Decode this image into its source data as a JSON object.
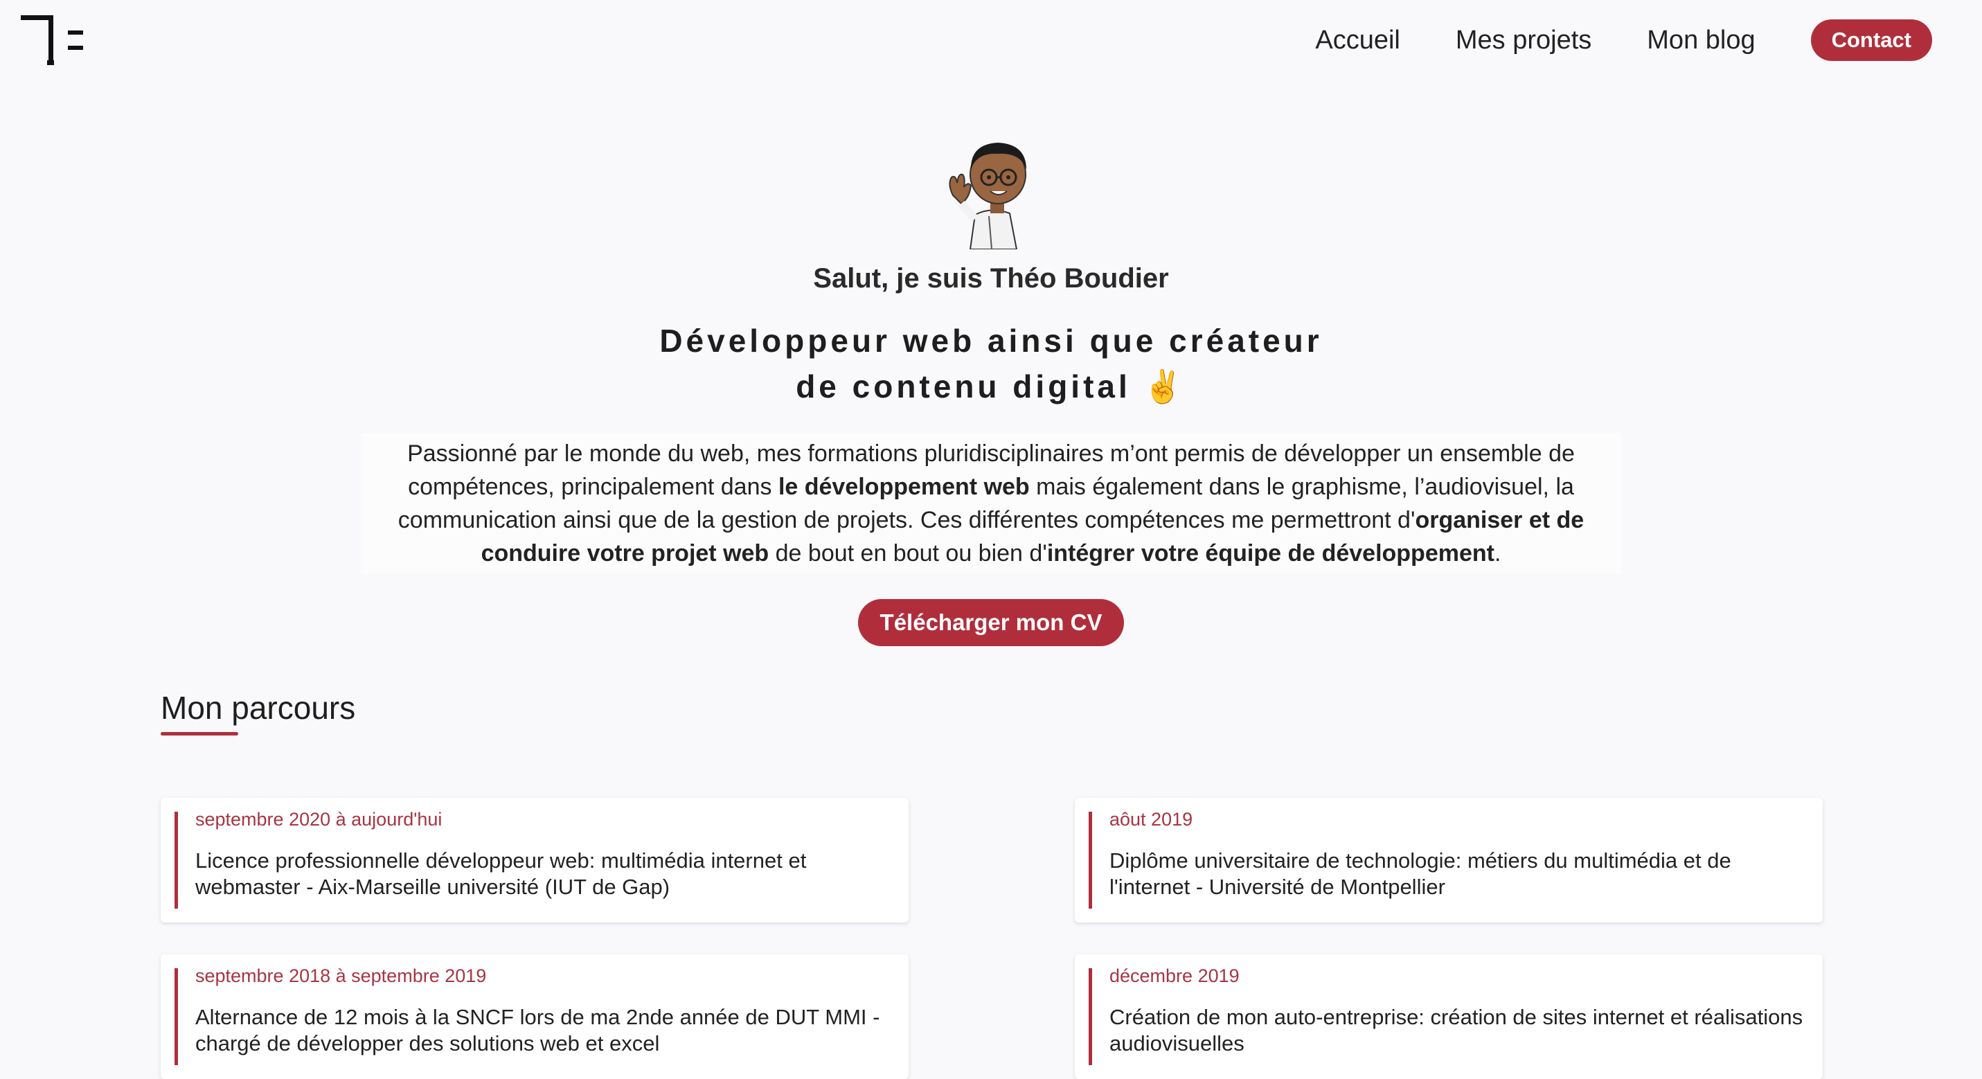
{
  "header": {
    "nav": [
      "Accueil",
      "Mes projets",
      "Mon blog"
    ],
    "cta_label": "Contact"
  },
  "hero": {
    "greeting": "Salut, je suis Théo Boudier",
    "tagline_line1": "Développeur web ainsi que créateur",
    "tagline_line2": "de contenu digital ✌️",
    "intro": {
      "p1": "Passionné par le monde du web, mes formations pluridisciplinaires m’ont permis de développer un ensemble de compétences, principalement dans ",
      "b1": "le développement web",
      "p2": " mais également dans le graphisme, l’audiovisuel, la communication ainsi que de la gestion de projets. Ces différentes compétences me permettront d'",
      "b2": "organiser et de conduire votre projet web",
      "p3": " de bout en bout ou bien d'",
      "b3": "intégrer votre équipe de développement",
      "p4": "."
    },
    "cv_button": "Télécharger mon CV"
  },
  "section": {
    "title": "Mon parcours"
  },
  "timeline": [
    {
      "date": "septembre 2020 à aujourd'hui",
      "text": "Licence professionnelle développeur web: multimédia internet et webmaster - Aix-Marseille université (IUT de Gap)"
    },
    {
      "date": "aôut 2019",
      "text": "Diplôme universitaire de technologie: métiers du multimédia et de l'internet - Université de Montpellier"
    },
    {
      "date": "septembre 2018 à septembre 2019",
      "text": "Alternance de 12 mois à la SNCF lors de ma 2nde année de DUT MMI - chargé de développer des solutions web et excel"
    },
    {
      "date": "décembre 2019",
      "text": "Création de mon auto-entreprise: création de sites internet et réalisations audiovisuelles"
    }
  ]
}
